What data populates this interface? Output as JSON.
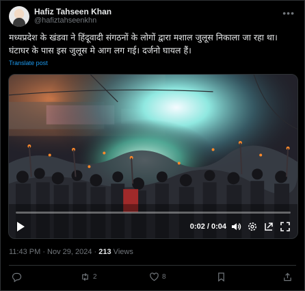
{
  "author": {
    "display_name": "Hafiz Tahseen Khan",
    "handle": "@hafiztahseenkhn"
  },
  "tweet": {
    "text": "मध्यप्रदेश के खंडवा ने हिंदूवादी संगठनों के लोगों द्वारा मशाल जुलूस निकाला जा रहा था। घंटाघर के पास इस जुलूस मे आग लग गई। दर्जनो घायल हैं।",
    "translate_label": "Translate post"
  },
  "video": {
    "progress": 0.0,
    "time_label": "0:02 / 0:04"
  },
  "meta": {
    "timestamp": "11:43 PM · Nov 29, 2024 · ",
    "views_count": "213",
    "views_label": " Views"
  },
  "actions": {
    "reply_count": "",
    "repost_count": "2",
    "like_count": "8"
  },
  "colors": {
    "accent": "#1d9bf0",
    "muted": "#71767b",
    "text": "#e7e9ea",
    "border": "#2f3336"
  },
  "icons": [
    "more-icon",
    "play-icon",
    "volume-icon",
    "settings-icon",
    "pip-icon",
    "fullscreen-icon",
    "reply-icon",
    "repost-icon",
    "like-icon",
    "bookmark-icon",
    "share-icon"
  ]
}
